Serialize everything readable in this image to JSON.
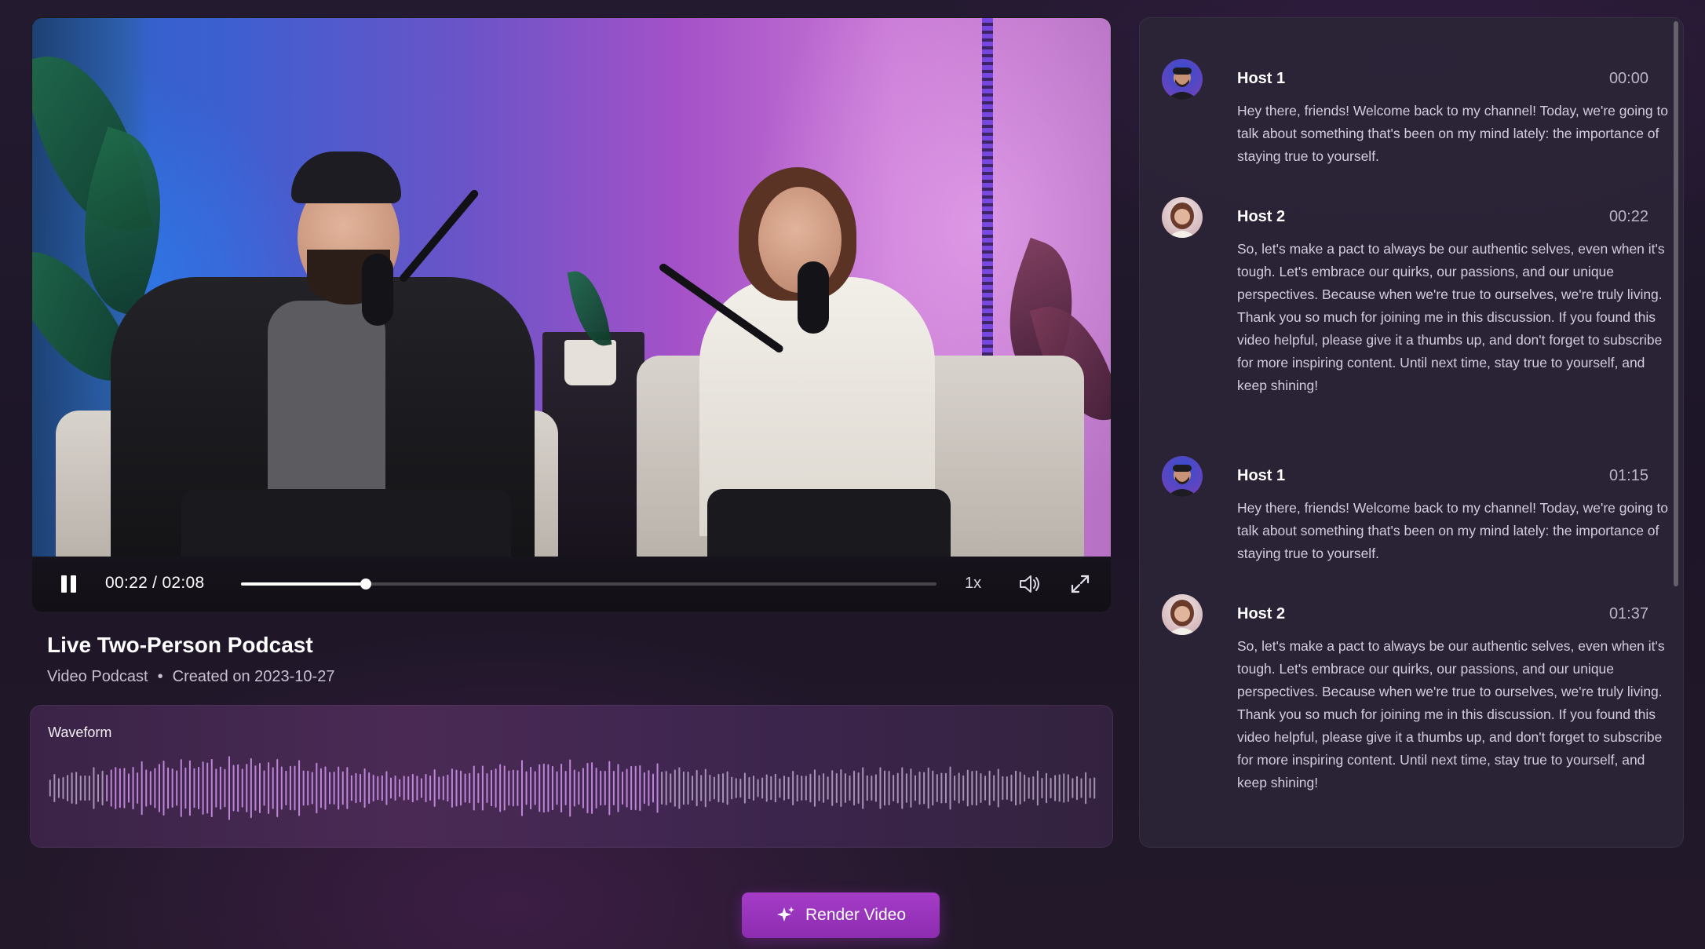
{
  "player": {
    "current_time": "00:22",
    "duration": "02:08",
    "time_display": "00:22 / 02:08",
    "progress_fraction": 0.18,
    "speed_label": "1x",
    "pause_icon": "pause-icon",
    "volume_icon": "volume-icon",
    "fullscreen_icon": "fullscreen-icon"
  },
  "video": {
    "title": "Live Two-Person Podcast",
    "type": "Video Podcast",
    "separator": "•",
    "created": "Created on 2023-10-27"
  },
  "waveform": {
    "label": "Waveform"
  },
  "actions": {
    "render_label": "Render Video",
    "render_icon": "sparkle-icon",
    "accent_color": "#9b33c0"
  },
  "transcript": {
    "entries": [
      {
        "speaker": "Host 1",
        "time": "00:00",
        "paragraphs": [
          "Hey there, friends! Welcome back to my channel! Today, we're going to talk about something that's been on my mind lately: the importance of staying true to yourself."
        ]
      },
      {
        "speaker": "Host 2",
        "time": "00:22",
        "paragraphs": [
          "So, let's make a pact to always be our authentic selves, even when it's tough. Let's embrace our quirks, our passions, and our unique perspectives. Because when we're true to ourselves, we're truly living.",
          "Thank you so much for joining me in this discussion. If you found this video helpful, please give it a thumbs up, and don't forget to subscribe for more inspiring content. Until next time, stay true to yourself, and keep shining!"
        ]
      },
      {
        "speaker": "Host 1",
        "time": "01:15",
        "paragraphs": [
          "Hey there, friends! Welcome back to my channel! Today, we're going to talk about something that's been on my mind lately: the importance of staying true to yourself."
        ]
      },
      {
        "speaker": "Host 2",
        "time": "01:37",
        "paragraphs": [
          "So, let's make a pact to always be our authentic selves, even when it's tough. Let's embrace our quirks, our passions, and our unique perspectives. Because when we're true to ourselves, we're truly living.",
          "Thank you so much for joining me in this discussion. If you found this video helpful, please give it a thumbs up, and don't forget to subscribe for more inspiring content. Until next time, stay true to yourself, and keep shining!"
        ]
      }
    ]
  }
}
